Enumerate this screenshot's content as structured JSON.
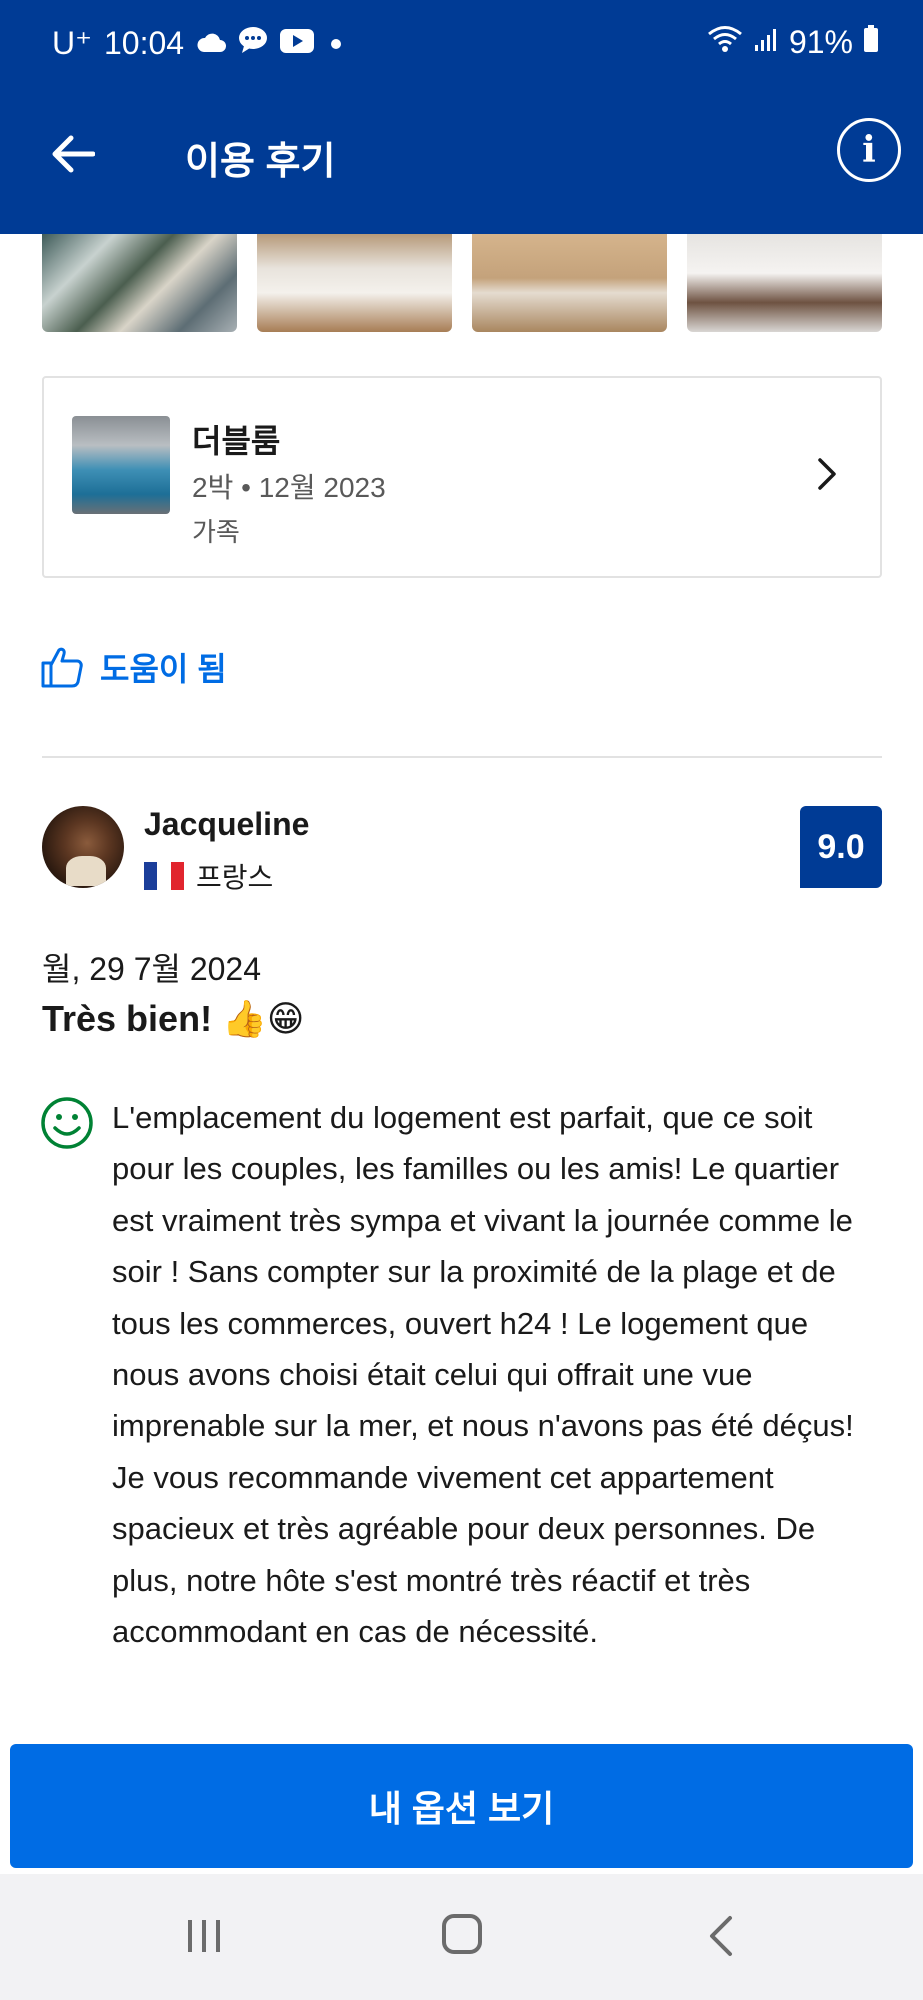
{
  "status_bar": {
    "carrier": "U⁺",
    "time": "10:04",
    "battery": "91%",
    "icons": [
      "cloud-icon",
      "chat-icon",
      "youtube-icon",
      "dot-icon",
      "wifi-icon",
      "signal-icon",
      "battery-icon"
    ]
  },
  "app_bar": {
    "title": "이용 후기",
    "back_icon": "arrow-left-icon",
    "info_icon": "info-icon",
    "info_glyph": "i"
  },
  "photos": [
    "photo-1",
    "photo-2",
    "photo-3",
    "photo-4"
  ],
  "room": {
    "name": "더블룸",
    "stay": "2박 • 12월 2023",
    "group": "가족"
  },
  "helpful": {
    "label": "도움이 됨"
  },
  "review": {
    "reviewer_name": "Jacqueline",
    "country": "프랑스",
    "score": "9.0",
    "date": "월, 29 7월 2024",
    "title": "Très bien! 👍😁",
    "body": "L'emplacement du logement est parfait, que ce soit pour les couples, les familles ou les amis! Le quartier est vraiment très sympa et vivant la journée comme le soir ! Sans compter sur la proximité de la plage et de tous les commerces, ouvert h24 ! Le logement que nous avons choisi était celui qui offrait une vue imprenable sur la mer, et nous n'avons pas été déçus! Je vous recommande vivement cet appartement spacieux et très agréable pour deux personnes. De plus, notre hôte s'est montré très réactif et très accommodant en cas de nécessité."
  },
  "cta": {
    "label": "내 옵션 보기"
  },
  "colors": {
    "brand_dark": "#003b95",
    "brand_action": "#006ce4",
    "positive": "#008234"
  }
}
